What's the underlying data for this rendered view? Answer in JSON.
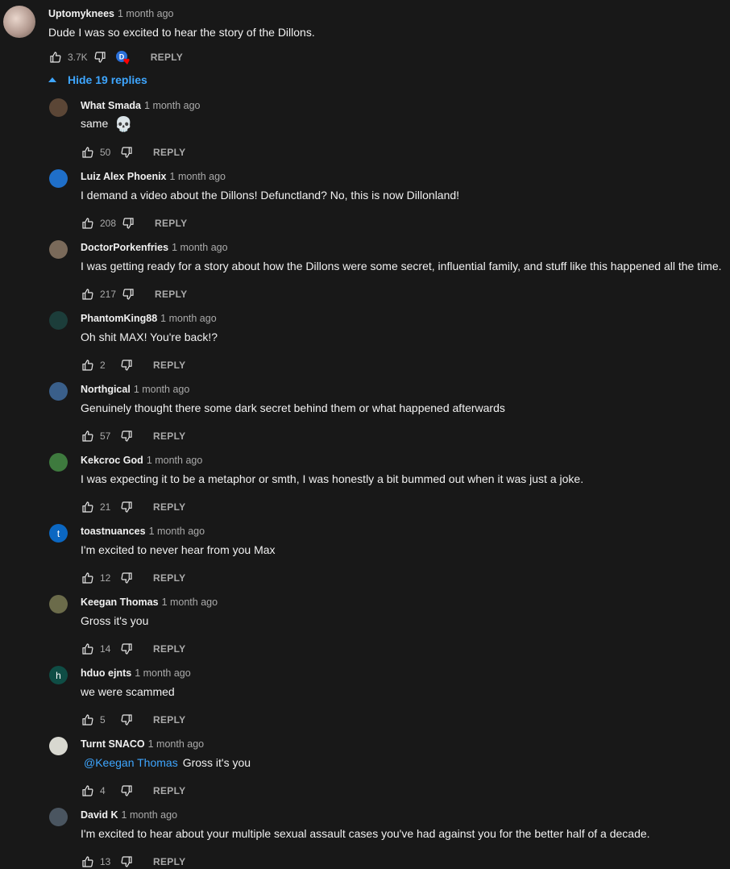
{
  "main_comment": {
    "author": "Uptomyknees",
    "time": "1 month ago",
    "text": "Dude I was so excited to hear the story of the Dillons.",
    "likes": "3.7K",
    "reply_label": "REPLY"
  },
  "toggle_replies_label": "Hide 19 replies",
  "replies": [
    {
      "author": "What Smada",
      "time": "1 month ago",
      "text": "same",
      "emoji": "💀",
      "likes": "50",
      "reply_label": "REPLY",
      "avatar_color": "#5b4636"
    },
    {
      "author": "Luiz Alex Phoenix",
      "time": "1 month ago",
      "text": "I demand a video about the Dillons! Defunctland? No, this is now Dillonland!",
      "likes": "208",
      "reply_label": "REPLY",
      "avatar_color": "#1f6fc9"
    },
    {
      "author": "DoctorPorkenfries",
      "time": "1 month ago",
      "text": "I was getting ready for a story about how the Dillons were some secret, influential family, and stuff like this happened all the time.",
      "likes": "217",
      "reply_label": "REPLY",
      "avatar_color": "#7a6a5a"
    },
    {
      "author": "PhantomKing88",
      "time": "1 month ago",
      "text": "Oh shit MAX! You're back!?",
      "likes": "2",
      "reply_label": "REPLY",
      "avatar_color": "#1c3d3a"
    },
    {
      "author": "Northgical",
      "time": "1 month ago",
      "text": "Genuinely thought there some dark secret behind them or what happened afterwards",
      "likes": "57",
      "reply_label": "REPLY",
      "avatar_color": "#3a5f8a"
    },
    {
      "author": "Kekcroc God",
      "time": "1 month ago",
      "text": "I was expecting it to be a metaphor or smth, I was honestly a bit bummed out when it was just a joke.",
      "likes": "21",
      "reply_label": "REPLY",
      "avatar_color": "#3e7a3e"
    },
    {
      "author": "toastnuances",
      "time": "1 month ago",
      "text": "I'm excited to never hear from you Max",
      "likes": "12",
      "reply_label": "REPLY",
      "avatar_color": "#0b67c2",
      "initial": "t"
    },
    {
      "author": "Keegan Thomas",
      "time": "1 month ago",
      "text": "Gross it's you",
      "likes": "14",
      "reply_label": "REPLY",
      "avatar_color": "#6b6b4a"
    },
    {
      "author": "hduo ejnts",
      "time": "1 month ago",
      "text": "we were scammed",
      "likes": "5",
      "reply_label": "REPLY",
      "avatar_color": "#0f4d45",
      "initial": "h"
    },
    {
      "author": "Turnt SNACO",
      "time": "1 month ago",
      "mention": "@Keegan Thomas",
      "text": "Gross it's you",
      "likes": "4",
      "reply_label": "REPLY",
      "avatar_color": "#d8d8d0"
    },
    {
      "author": "David K",
      "time": "1 month ago",
      "text": "I'm excited to hear about your multiple sexual assault cases you've had against you for the better half of a decade.",
      "likes": "13",
      "reply_label": "REPLY",
      "avatar_color": "#4a5560"
    }
  ],
  "colors": {
    "background": "#181818",
    "text_primary": "#f1f1f1",
    "text_secondary": "#aaaaaa",
    "link": "#3ea6ff",
    "heart": "#ff0000"
  },
  "icons": {
    "like": "thumb-up-icon",
    "dislike": "thumb-down-icon",
    "creator_heart": "creator-heart-icon",
    "collapse": "triangle-up-icon"
  }
}
